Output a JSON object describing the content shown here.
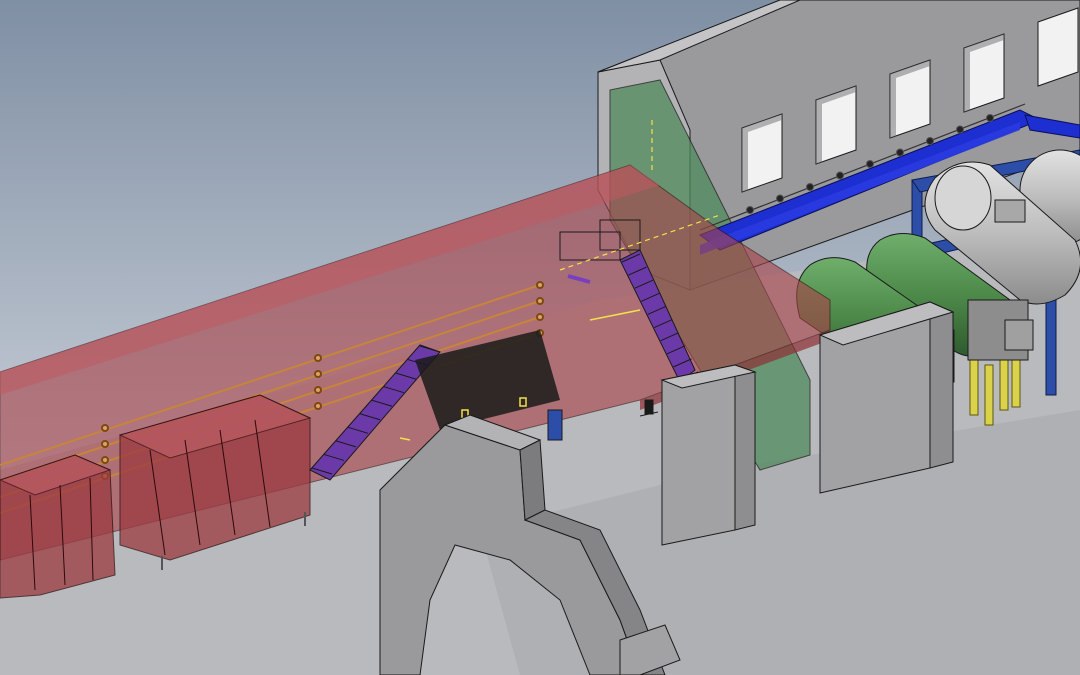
{
  "viewport": {
    "background_top": "#7f8fa4",
    "background_bottom": "#e6e8ec"
  },
  "colors": {
    "floor": "#b9babd",
    "floor_edge": "#8f9094",
    "wall": "#9a9a9c",
    "wall_dark": "#6f6f72",
    "wall_light": "#b3b3b6",
    "enclosure": "#a8444a",
    "enclosure_alpha": 0.62,
    "enclosure_top": "#c05a60",
    "glass": "#4f8a5c",
    "conveyor": "#1d2fd1",
    "conveyor_purple": "#6b3aa8",
    "tank_green": "#4d8a4a",
    "tank_gray": "#bdbdbd",
    "support_yellow": "#d9d24a",
    "support_blue": "#2c4ea8",
    "pipe_orange": "#c8843a",
    "line_yellow": "#f2e04a",
    "outline": "#1a1a1a",
    "pillar": "#8e8e90",
    "pillar_face": "#a2a2a4"
  },
  "components": [
    {
      "name": "building-wall",
      "label": ""
    },
    {
      "name": "transparent-enclosure",
      "label": ""
    },
    {
      "name": "infeed-hoppers",
      "label": ""
    },
    {
      "name": "inclined-conveyor-left",
      "label": ""
    },
    {
      "name": "inclined-conveyor-center",
      "label": ""
    },
    {
      "name": "overhead-conveyor",
      "label": ""
    },
    {
      "name": "green-tank-1",
      "label": ""
    },
    {
      "name": "green-tank-2",
      "label": ""
    },
    {
      "name": "gray-tank-1",
      "label": ""
    },
    {
      "name": "gray-tank-2",
      "label": ""
    },
    {
      "name": "concrete-pillars",
      "label": ""
    },
    {
      "name": "arch-portal",
      "label": ""
    }
  ]
}
